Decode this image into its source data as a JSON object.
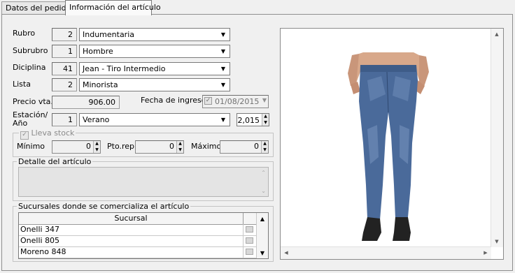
{
  "tabs": [
    {
      "label": "Datos del pedido"
    },
    {
      "label": "Información del artículo"
    }
  ],
  "form": {
    "rubro": {
      "label": "Rubro",
      "code": "2",
      "value": "Indumentaria"
    },
    "subrubro": {
      "label": "Subrubro",
      "code": "1",
      "value": "Hombre"
    },
    "diciplina": {
      "label": "Diciplina",
      "code": "41",
      "value": "Jean - Tiro Intermedio"
    },
    "lista": {
      "label": "Lista",
      "code": "2",
      "value": "Minorista"
    },
    "precio": {
      "label": "Precio vta.",
      "value": "906.00"
    },
    "fecha": {
      "label": "Fecha de ingreso",
      "value": "01/08/2015",
      "checked": true
    },
    "estacion": {
      "label1": "Estación/",
      "label2": "Año",
      "code": "1",
      "value": "Verano",
      "year": "2,015"
    }
  },
  "stock": {
    "checkbox_label": "Lleva stock",
    "minimo_label": "Mínimo",
    "minimo_value": "0",
    "ptorep_label": "Pto.rep.",
    "ptorep_value": "0",
    "maximo_label": "Máximo",
    "maximo_value": "0"
  },
  "detalle": {
    "title": "Detalle del artículo",
    "value": ""
  },
  "sucursales": {
    "title": "Sucursales donde se comercializa el artículo",
    "column": "Sucursal",
    "rows": [
      {
        "name": "Onelli 347"
      },
      {
        "name": "Onelli 805"
      },
      {
        "name": "Moreno 848"
      }
    ]
  },
  "icons": {
    "dropdown": "chevron-down-icon",
    "spin": "spinner-arrows-icon",
    "scroll_up": "arrow-up-icon",
    "scroll_down": "arrow-down-icon",
    "scroll_left": "arrow-left-icon",
    "scroll_right": "arrow-right-icon",
    "product_image": "jeans-product-photo"
  },
  "colors": {
    "window_bg": "#f0f0f0",
    "field_bg": "#ffffff",
    "jeans": "#4a6a9a"
  }
}
